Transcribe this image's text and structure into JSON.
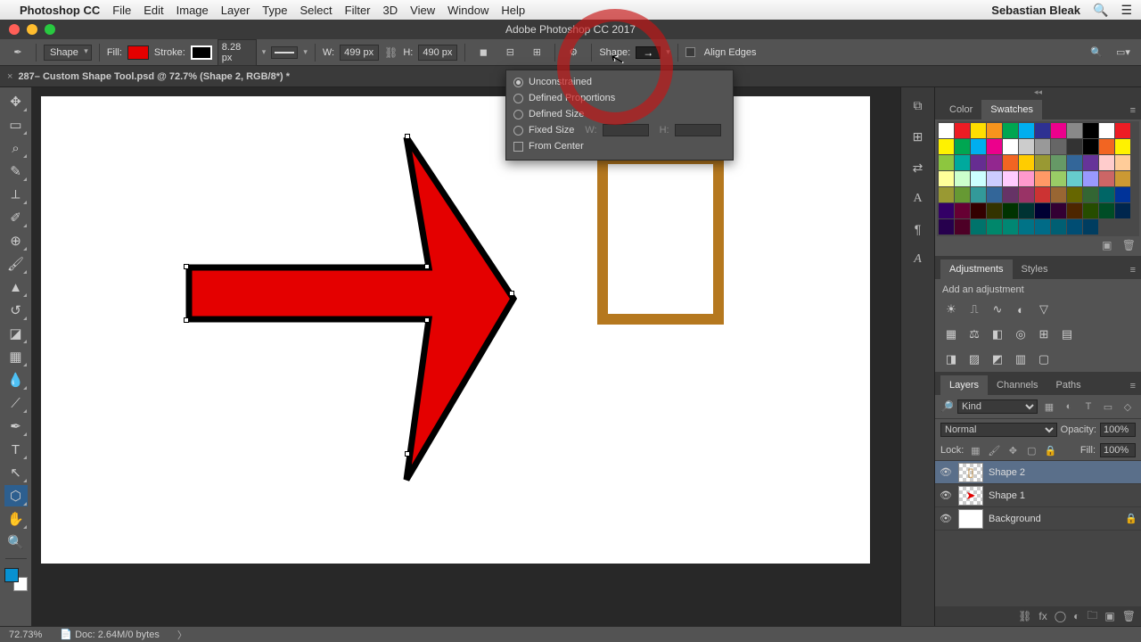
{
  "mac": {
    "app": "Photoshop CC",
    "menus": [
      "File",
      "Edit",
      "Image",
      "Layer",
      "Type",
      "Select",
      "Filter",
      "3D",
      "View",
      "Window",
      "Help"
    ],
    "user": "Sebastian Bleak"
  },
  "window": {
    "title": "Adobe Photoshop CC 2017"
  },
  "options": {
    "mode": "Shape",
    "fill_label": "Fill:",
    "stroke_label": "Stroke:",
    "stroke_size": "8.28 px",
    "w_label": "W:",
    "w_val": "499 px",
    "h_label": "H:",
    "h_val": "490 px",
    "shape_label": "Shape:",
    "align_label": "Align Edges"
  },
  "tab": {
    "name": "287– Custom Shape Tool.psd @ 72.7% (Shape 2, RGB/8*) *"
  },
  "popup": {
    "opts": [
      "Unconstrained",
      "Defined Proportions",
      "Defined Size",
      "Fixed Size"
    ],
    "selected": 0,
    "w": "W:",
    "h": "H:",
    "from_center": "From Center"
  },
  "panels": {
    "color_tab": "Color",
    "swatches_tab": "Swatches",
    "adjustments_tab": "Adjustments",
    "styles_tab": "Styles",
    "add_adj": "Add an adjustment",
    "layers_tab": "Layers",
    "channels_tab": "Channels",
    "paths_tab": "Paths"
  },
  "layers": {
    "filter_kind": "Kind",
    "blend": "Normal",
    "opacity_label": "Opacity:",
    "opacity_val": "100%",
    "lock_label": "Lock:",
    "fill_label": "Fill:",
    "fill_val": "100%",
    "items": [
      {
        "name": "Shape 2",
        "sel": true,
        "thumb": "frame"
      },
      {
        "name": "Shape 1",
        "sel": false,
        "thumb": "arrow"
      },
      {
        "name": "Background",
        "sel": false,
        "thumb": "white",
        "locked": true
      }
    ]
  },
  "status": {
    "zoom": "72.73%",
    "doc": "Doc: 2.64M/0 bytes"
  },
  "swatches_colors": [
    "#ffffff",
    "#ed1c24",
    "#ffde00",
    "#f7941d",
    "#00a651",
    "#00aeef",
    "#2e3192",
    "#ec008c",
    "#898989",
    "#000000",
    "#ffffff",
    "#ed1c24",
    "#fff200",
    "#00a651",
    "#00aeef",
    "#ec008c",
    "#ffffff",
    "#cccccc",
    "#999999",
    "#666666",
    "#333333",
    "#000000",
    "#f26522",
    "#fff200",
    "#8dc63f",
    "#00a99d",
    "#662d91",
    "#92278f",
    "#f26522",
    "#ffcc00",
    "#999933",
    "#669966",
    "#336699",
    "#663399",
    "#ffcccc",
    "#ffcc99",
    "#ffff99",
    "#ccffcc",
    "#ccffff",
    "#ccccff",
    "#ffccff",
    "#ff99cc",
    "#ff9966",
    "#99cc66",
    "#66cccc",
    "#9999ff",
    "#cc6666",
    "#cc9933",
    "#999933",
    "#669933",
    "#339999",
    "#336699",
    "#663366",
    "#993366",
    "#cc3333",
    "#996633",
    "#666600",
    "#336633",
    "#006666",
    "#003399",
    "#330066",
    "#660033",
    "#330000",
    "#333300",
    "#003300",
    "#003333",
    "#000033",
    "#330033",
    "#4d2600",
    "#264d00",
    "#004d26",
    "#00264d",
    "#26004d",
    "#4d0026",
    "#00736b",
    "#00876b",
    "#008773",
    "#007387",
    "#006b87",
    "#005f73",
    "#004d73",
    "#003d60"
  ]
}
